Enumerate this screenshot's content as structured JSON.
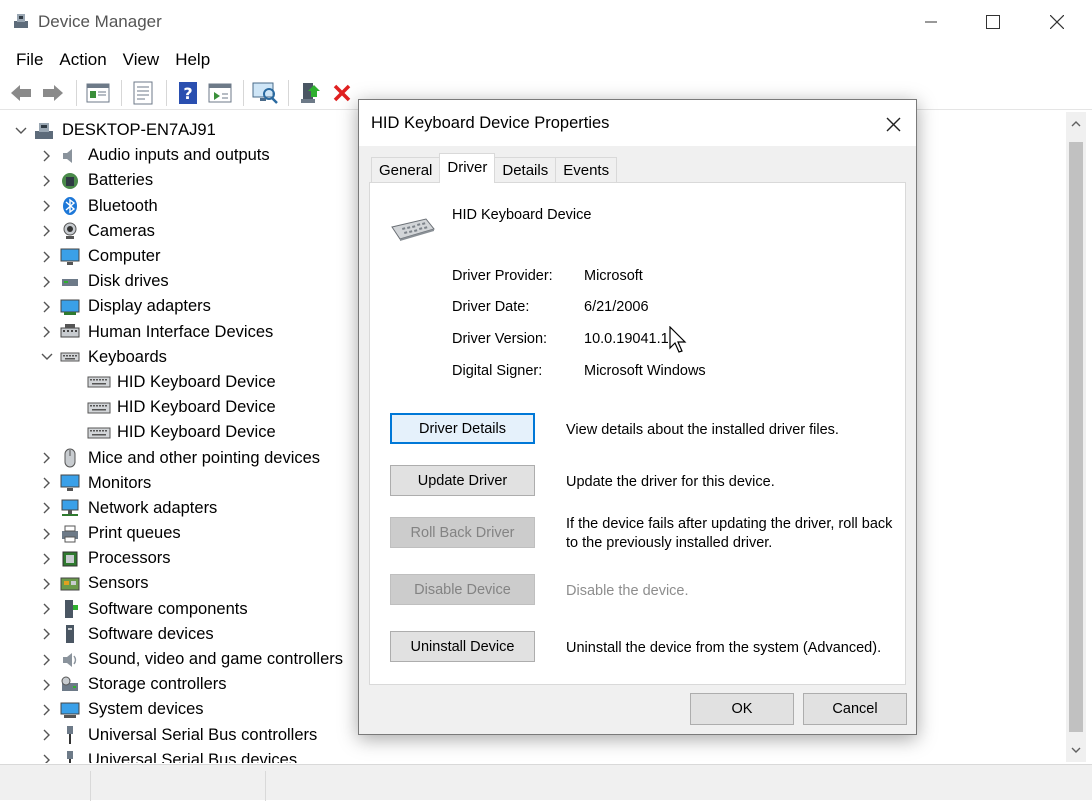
{
  "window": {
    "title": "Device Manager"
  },
  "menu": [
    "File",
    "Action",
    "View",
    "Help"
  ],
  "toolbar": {
    "buttons": [
      "back-icon",
      "forward-icon",
      "properties-icon",
      "update-list-icon",
      "help-icon",
      "show-hidden-icon",
      "scan-hardware-icon",
      "enable-device-icon",
      "uninstall-icon"
    ]
  },
  "tree": {
    "root": "DESKTOP-EN7AJ91",
    "categories": [
      "Audio inputs and outputs",
      "Batteries",
      "Bluetooth",
      "Cameras",
      "Computer",
      "Disk drives",
      "Display adapters",
      "Human Interface Devices",
      "Keyboards",
      "Mice and other pointing devices",
      "Monitors",
      "Network adapters",
      "Print queues",
      "Processors",
      "Sensors",
      "Software components",
      "Software devices",
      "Sound, video and game controllers",
      "Storage controllers",
      "System devices",
      "Universal Serial Bus controllers",
      "Universal Serial Bus devices"
    ],
    "keyboards_children": [
      "HID Keyboard Device",
      "HID Keyboard Device",
      "HID Keyboard Device"
    ]
  },
  "dialog": {
    "title": "HID Keyboard Device Properties",
    "tabs": [
      "General",
      "Driver",
      "Details",
      "Events"
    ],
    "active_tab": "Driver",
    "device_name": "HID Keyboard Device",
    "info": {
      "provider_label": "Driver Provider:",
      "provider_value": "Microsoft",
      "date_label": "Driver Date:",
      "date_value": "6/21/2006",
      "version_label": "Driver Version:",
      "version_value": "10.0.19041.1",
      "signer_label": "Digital Signer:",
      "signer_value": "Microsoft Windows"
    },
    "buttons": {
      "driver_details": "Driver Details",
      "driver_details_desc": "View details about the installed driver files.",
      "update_driver": "Update Driver",
      "update_driver_desc": "Update the driver for this device.",
      "roll_back": "Roll Back Driver",
      "roll_back_desc": "If the device fails after updating the driver, roll back to the previously installed driver.",
      "disable": "Disable Device",
      "disable_desc": "Disable the device.",
      "uninstall": "Uninstall Device",
      "uninstall_desc": "Uninstall the device from the system (Advanced)."
    },
    "ok": "OK",
    "cancel": "Cancel"
  },
  "colors": {
    "accent": "#0078d7",
    "dialog_bg": "#f0f0f0",
    "disabled_text": "#838383"
  }
}
